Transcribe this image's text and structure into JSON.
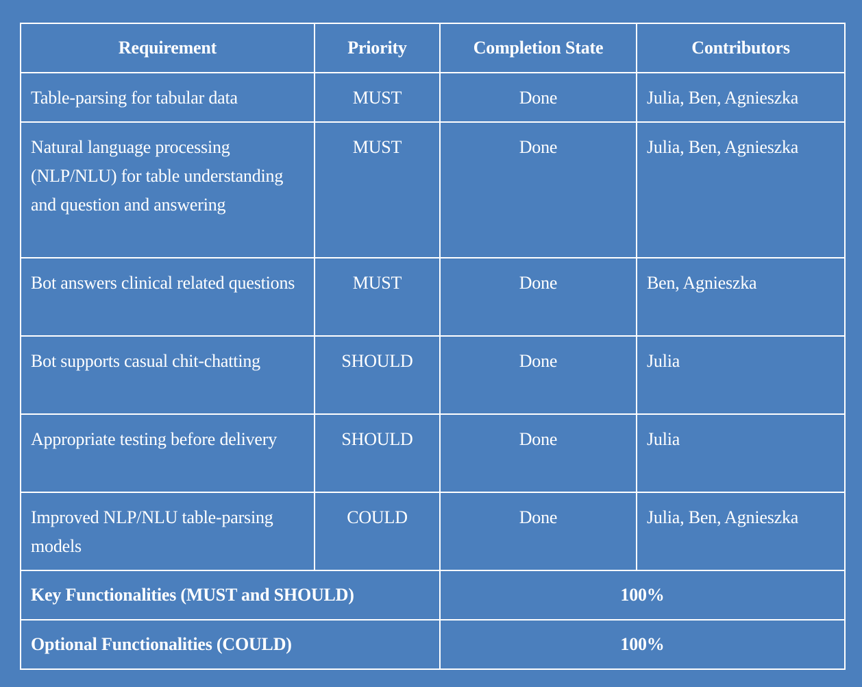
{
  "colors": {
    "background": "#4b7fbd",
    "text": "#ffffff",
    "border": "#ffffff"
  },
  "table": {
    "headers": [
      "Requirement",
      "Priority",
      "Completion State",
      "Contributors"
    ],
    "rows": [
      {
        "requirement": "Table-parsing for tabular data",
        "priority": "MUST",
        "state": "Done",
        "contributors": "Julia, Ben, Agnieszka"
      },
      {
        "requirement": "Natural language processing (NLP/NLU) for table understanding and question and answering",
        "priority": "MUST",
        "state": "Done",
        "contributors": "Julia, Ben, Agnieszka"
      },
      {
        "requirement": "Bot answers clinical related questions",
        "priority": "MUST",
        "state": "Done",
        "contributors": "Ben, Agnieszka"
      },
      {
        "requirement": "Bot supports casual chit-chatting",
        "priority": "SHOULD",
        "state": "Done",
        "contributors": "Julia"
      },
      {
        "requirement": "Appropriate testing before delivery",
        "priority": "SHOULD",
        "state": "Done",
        "contributors": "Julia"
      },
      {
        "requirement": "Improved NLP/NLU table-parsing models",
        "priority": "COULD",
        "state": "Done",
        "contributors": "Julia, Ben, Agnieszka"
      }
    ],
    "summary": [
      {
        "label": "Key Functionalities (MUST and SHOULD)",
        "value": "100%"
      },
      {
        "label": "Optional Functionalities (COULD)",
        "value": "100%"
      }
    ]
  }
}
